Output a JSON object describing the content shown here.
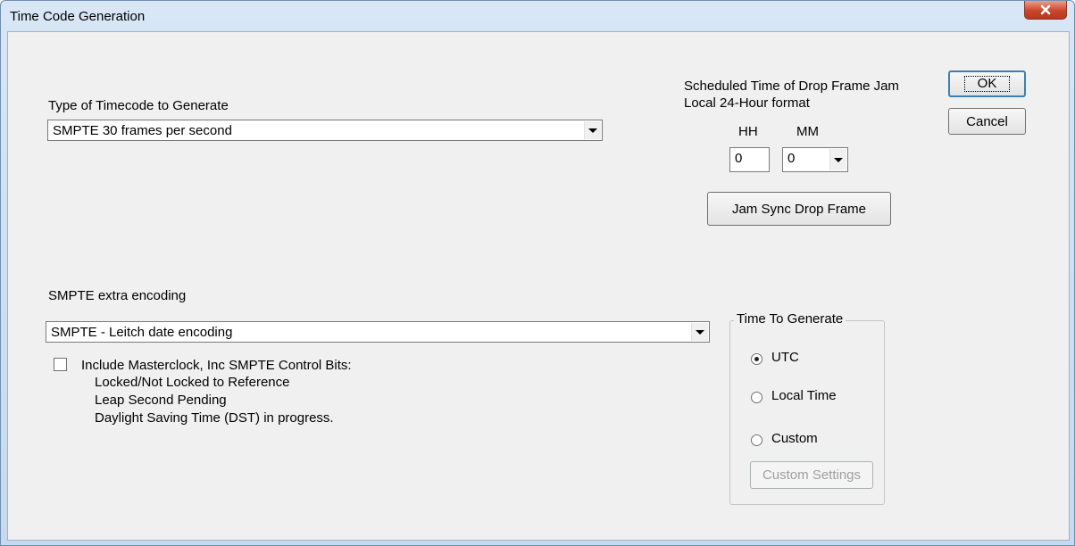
{
  "window": {
    "title": "Time Code Generation",
    "close_glyph": "✕"
  },
  "timecode_type": {
    "label": "Type of Timecode to Generate",
    "selected": "SMPTE 30 frames per second"
  },
  "drop_frame_jam": {
    "heading_line1": "Scheduled Time of Drop Frame Jam",
    "heading_line2": "Local 24-Hour format",
    "hh_label": "HH",
    "mm_label": "MM",
    "hh_value": "0",
    "mm_value": "0",
    "jam_button": "Jam Sync Drop Frame"
  },
  "buttons": {
    "ok": "OK",
    "cancel": "Cancel"
  },
  "extra_encoding": {
    "label": "SMPTE extra encoding",
    "selected": "SMPTE - Leitch date encoding"
  },
  "control_bits": {
    "checked": false,
    "label": "Include Masterclock, Inc SMPTE Control Bits:",
    "line1": "Locked/Not Locked to Reference",
    "line2": "Leap Second Pending",
    "line3": "Daylight Saving Time (DST) in progress."
  },
  "time_to_generate": {
    "group_label": "Time To Generate",
    "options": [
      "UTC",
      "Local Time",
      "Custom"
    ],
    "selected": "UTC",
    "custom_settings_button": "Custom Settings"
  }
}
